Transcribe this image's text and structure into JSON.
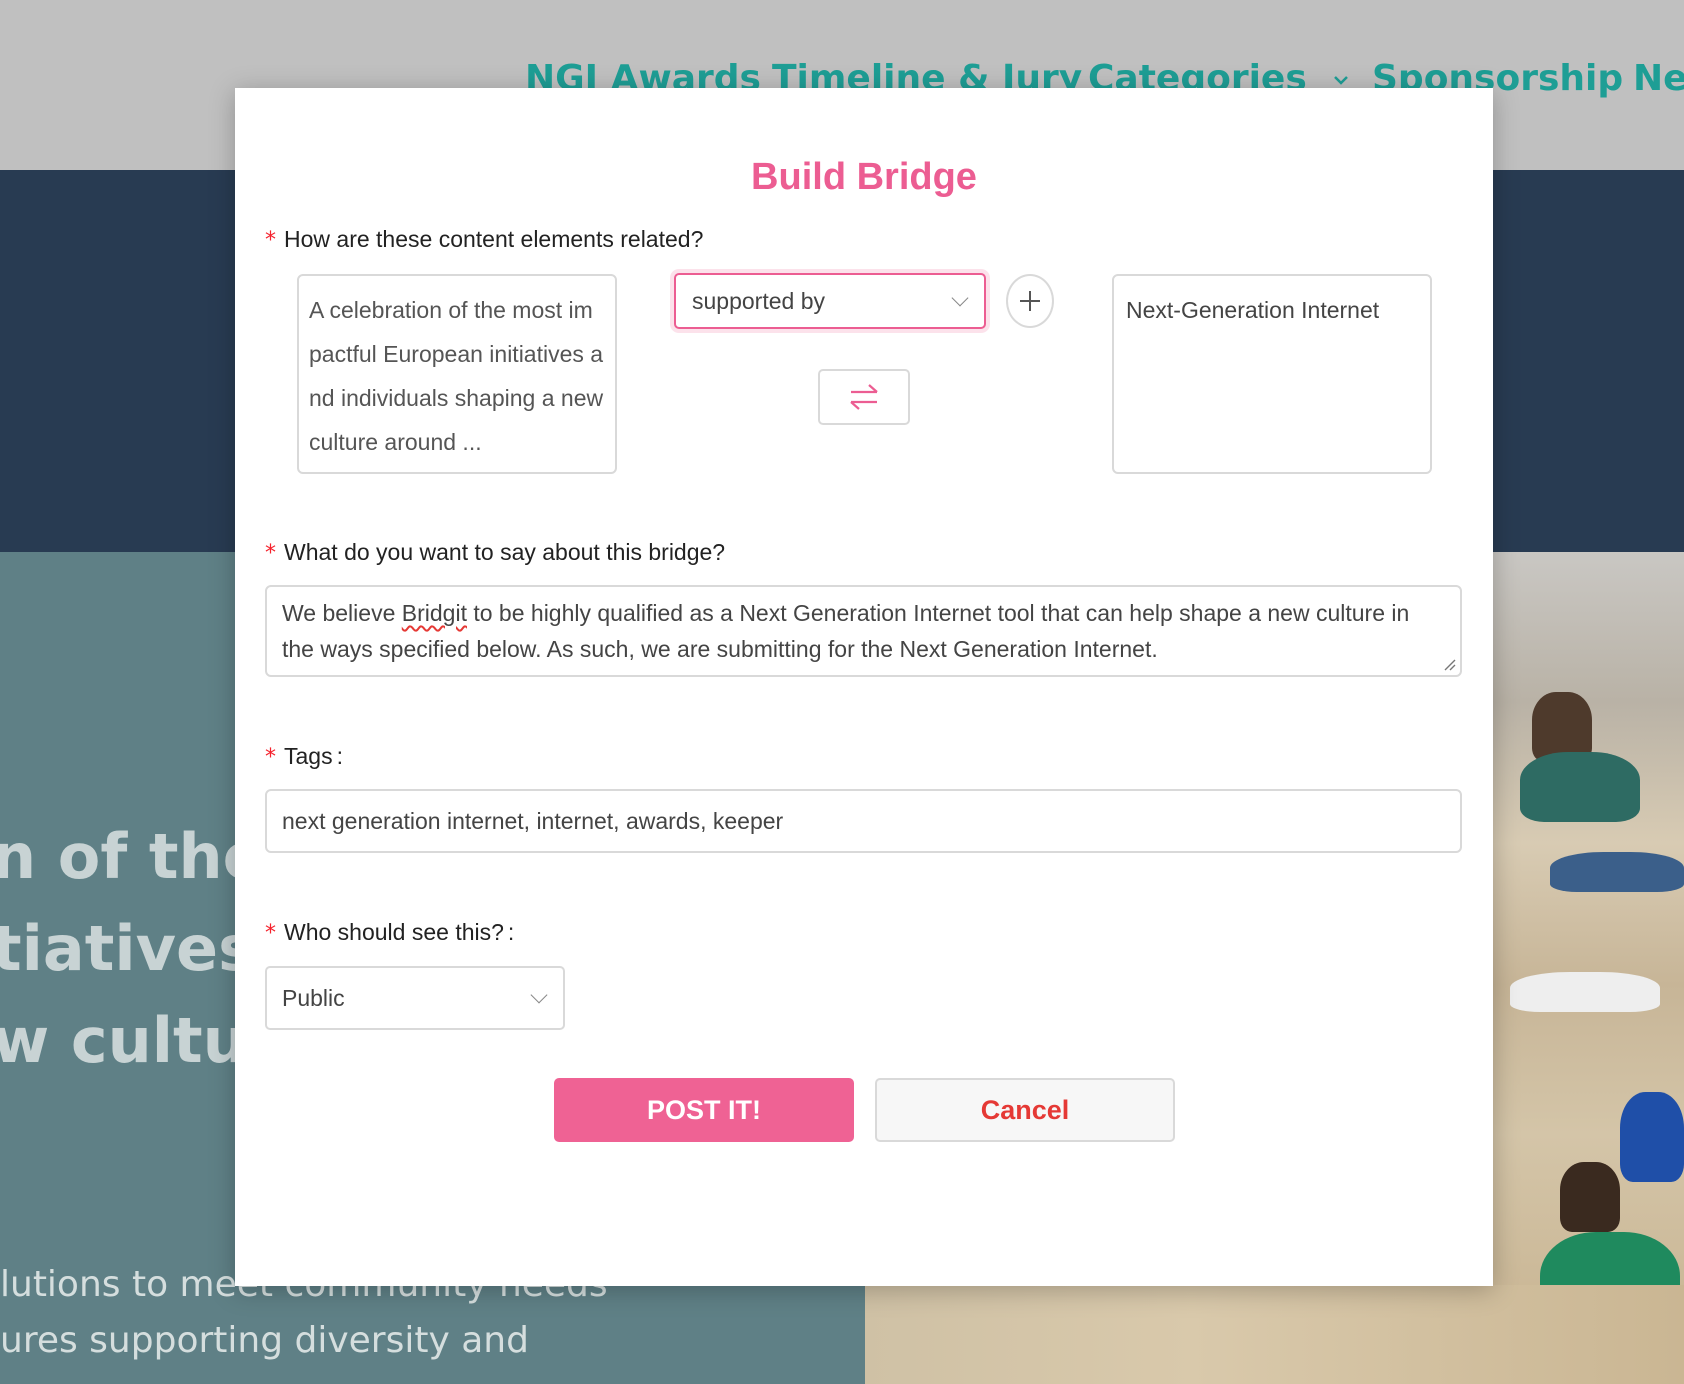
{
  "background": {
    "nav_items": [
      "NGI Awards",
      "Timeline & Jury",
      "Categories",
      "Sponsorship",
      "Ne"
    ],
    "categories_chevron": "chevron-down",
    "hero_lines": [
      "n of the m",
      "tiatives a",
      "w culture"
    ],
    "sub_lines": [
      "lutions to meet community needs",
      "ures supporting diversity and"
    ]
  },
  "modal": {
    "title": "Build Bridge",
    "required_mark": "*",
    "relation": {
      "label": "How are these content elements related?",
      "source_text": "A celebration of the most impactful European initiatives and individuals shaping a new culture around ...",
      "selected": "supported by",
      "target_text": "Next-Generation Internet",
      "add_icon": "plus-circle-icon",
      "swap_icon": "swap-arrows-icon"
    },
    "description": {
      "label": "What do you want to say about this bridge?",
      "value_before": "We believe ",
      "value_misspelled": "Bridgit",
      "value_after": " to be highly qualified as a Next Generation Internet tool that can help shape a new culture in the ways specified below.  As such, we are submitting for the Next Generation Internet."
    },
    "tags": {
      "label": "Tags",
      "colon": ":",
      "value": "next generation internet, internet, awards, keeper"
    },
    "visibility": {
      "label": "Who should see this?",
      "colon": ":",
      "selected": "Public"
    },
    "buttons": {
      "post": "POST IT!",
      "cancel": "Cancel"
    },
    "colors": {
      "accent": "#ec5d92",
      "required": "#f5222d",
      "cancel_text": "#e53935"
    }
  }
}
